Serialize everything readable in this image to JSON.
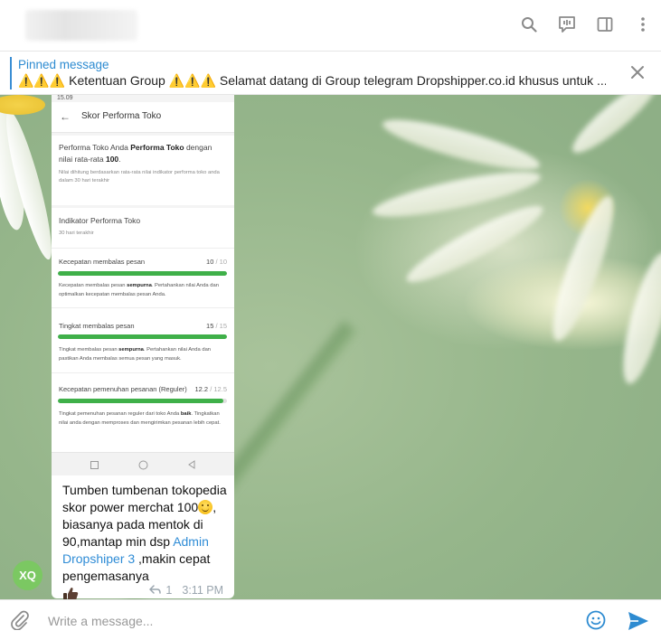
{
  "header": {
    "icons": [
      "search-icon",
      "voice-chat-icon",
      "sidebar-toggle-icon",
      "more-menu-icon"
    ]
  },
  "pinned": {
    "title": "Pinned message",
    "text": "⚠️⚠️⚠️ Ketentuan Group ⚠️⚠️⚠️ Selamat datang di Group telegram Dropshipper.co.id khusus untuk ..."
  },
  "message": {
    "screenshot": {
      "status_time": "15.09",
      "app_title": "Skor Performa Toko",
      "summary_prefix": "Performa Toko Anda ",
      "summary_bold": "Performa Toko",
      "summary_mid": " dengan nilai rata-rata ",
      "summary_score": "100",
      "summary_suffix": ".",
      "summary_note": "Nilai dihitung berdasarkan rata-rata nilai indikator performa toko anda dalam 30 hari terakhir",
      "indicator_title": "Indikator Performa Toko",
      "indicator_period": "30 hari terakhir",
      "metrics": [
        {
          "name": "Kecepatan membalas pesan",
          "score": "10",
          "max": "10",
          "fraction": 1.0,
          "desc_prefix": "Kecepatan membalas pesan ",
          "desc_bold": "sempurna",
          "desc_suffix": ". Pertahankan nilai Anda dan optimalkan kecepatan membalas pesan Anda."
        },
        {
          "name": "Tingkat membalas pesan",
          "score": "15",
          "max": "15",
          "fraction": 1.0,
          "desc_prefix": "Tingkat membalas pesan ",
          "desc_bold": "sempurna",
          "desc_suffix": ". Pertahankan nilai Anda dan pastikan Anda membalas semua pesan yang masuk."
        },
        {
          "name": "Kecepatan pemenuhan pesanan (Reguler)",
          "score": "12.2",
          "max": "12.5",
          "fraction": 0.976,
          "desc_prefix": "Tingkat pemenuhan pesanan reguler dari toko Anda ",
          "desc_bold": "baik",
          "desc_suffix": ". Tingkatkan nilai anda dengan memproses dan mengirimkan pesanan lebih cepat."
        }
      ]
    },
    "caption_part1": "Tumben tumbenan tokopedia skor power merchat 100",
    "caption_part2": ", biasanya pada mentok di 90,mantap min dsp ",
    "mention": "Admin Dropshiper 3",
    "caption_part3": " ,makin cepat pengemasanya",
    "reply_count": "1",
    "time": "3:11 PM",
    "avatar_initials": "XQ"
  },
  "composer": {
    "placeholder": "Write a message..."
  },
  "colors": {
    "accent": "#2d8bd1",
    "progress_green": "#3fb049",
    "avatar_green": "#7bc862"
  }
}
